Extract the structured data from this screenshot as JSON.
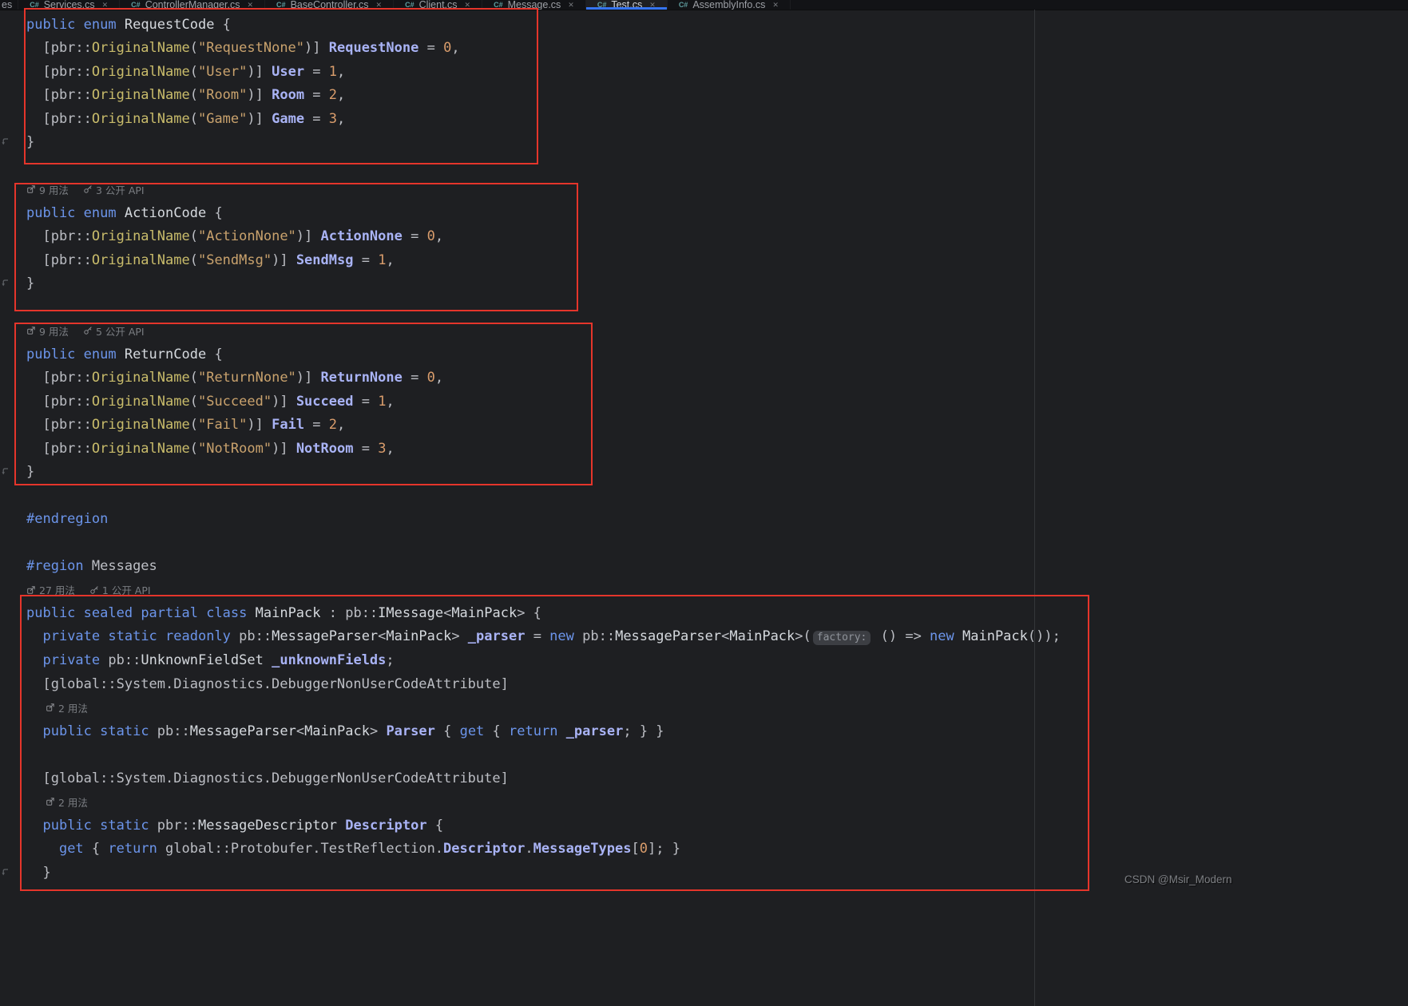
{
  "tabs": {
    "leading_fragment": "es",
    "icon_label": "C#",
    "close_glyph": "✕",
    "items": [
      {
        "label": "Services.cs",
        "active": false
      },
      {
        "label": "ControllerManager.cs",
        "active": false
      },
      {
        "label": "BaseController.cs",
        "active": false
      },
      {
        "label": "Client.cs",
        "active": false
      },
      {
        "label": "Message.cs",
        "active": false
      },
      {
        "label": "Test.cs",
        "active": true
      },
      {
        "label": "AssemblyInfo.cs",
        "active": false
      }
    ]
  },
  "watermark": {
    "text": "CSDN @Msir_Modern"
  },
  "colors": {
    "background": "#1E1F22",
    "annotation_red": "#E5352B",
    "active_tab_accent": "#3574F0",
    "keyword": "#6C95EB",
    "string": "#C9A26D",
    "number": "#DA9D6C",
    "member": "#A9B3F5",
    "method": "#C9BC6B"
  },
  "editor": {
    "lines": [
      {
        "type": "code",
        "tokens": [
          [
            "k",
            "public "
          ],
          [
            "k",
            "enum "
          ],
          [
            "t",
            "RequestCode"
          ],
          [
            "d",
            " {"
          ]
        ]
      },
      {
        "type": "code",
        "tokens": [
          [
            "d",
            "  [pbr::"
          ],
          [
            "m",
            "OriginalName"
          ],
          [
            "d",
            "("
          ],
          [
            "s",
            "\"RequestNone\""
          ],
          [
            "d",
            ")] "
          ],
          [
            "e",
            "RequestNone"
          ],
          [
            "d",
            " = "
          ],
          [
            "n",
            "0"
          ],
          [
            "d",
            ","
          ]
        ]
      },
      {
        "type": "code",
        "tokens": [
          [
            "d",
            "  [pbr::"
          ],
          [
            "m",
            "OriginalName"
          ],
          [
            "d",
            "("
          ],
          [
            "s",
            "\"User\""
          ],
          [
            "d",
            ")] "
          ],
          [
            "e",
            "User"
          ],
          [
            "d",
            " = "
          ],
          [
            "n",
            "1"
          ],
          [
            "d",
            ","
          ]
        ]
      },
      {
        "type": "code",
        "tokens": [
          [
            "d",
            "  [pbr::"
          ],
          [
            "m",
            "OriginalName"
          ],
          [
            "d",
            "("
          ],
          [
            "s",
            "\"Room\""
          ],
          [
            "d",
            ")] "
          ],
          [
            "e",
            "Room"
          ],
          [
            "d",
            " = "
          ],
          [
            "n",
            "2"
          ],
          [
            "d",
            ","
          ]
        ]
      },
      {
        "type": "code",
        "tokens": [
          [
            "d",
            "  [pbr::"
          ],
          [
            "m",
            "OriginalName"
          ],
          [
            "d",
            "("
          ],
          [
            "s",
            "\"Game\""
          ],
          [
            "d",
            ")] "
          ],
          [
            "e",
            "Game"
          ],
          [
            "d",
            " = "
          ],
          [
            "n",
            "3"
          ],
          [
            "d",
            ","
          ]
        ]
      },
      {
        "type": "code",
        "gutter": true,
        "tokens": [
          [
            "d",
            "}"
          ]
        ]
      },
      {
        "type": "blank"
      },
      {
        "type": "lens",
        "indent": 0,
        "items": [
          {
            "icon": "usages-icon",
            "text": "9 用法"
          },
          {
            "icon": "api-icon",
            "text": "3 公开 API"
          }
        ]
      },
      {
        "type": "code",
        "tokens": [
          [
            "k",
            "public "
          ],
          [
            "k",
            "enum "
          ],
          [
            "t",
            "ActionCode"
          ],
          [
            "d",
            " {"
          ]
        ]
      },
      {
        "type": "code",
        "tokens": [
          [
            "d",
            "  [pbr::"
          ],
          [
            "m",
            "OriginalName"
          ],
          [
            "d",
            "("
          ],
          [
            "s",
            "\"ActionNone\""
          ],
          [
            "d",
            ")] "
          ],
          [
            "e",
            "ActionNone"
          ],
          [
            "d",
            " = "
          ],
          [
            "n",
            "0"
          ],
          [
            "d",
            ","
          ]
        ]
      },
      {
        "type": "code",
        "tokens": [
          [
            "d",
            "  [pbr::"
          ],
          [
            "m",
            "OriginalName"
          ],
          [
            "d",
            "("
          ],
          [
            "s",
            "\"SendMsg\""
          ],
          [
            "d",
            ")] "
          ],
          [
            "e",
            "SendMsg"
          ],
          [
            "d",
            " = "
          ],
          [
            "n",
            "1"
          ],
          [
            "d",
            ","
          ]
        ]
      },
      {
        "type": "code",
        "gutter": true,
        "tokens": [
          [
            "d",
            "}"
          ]
        ]
      },
      {
        "type": "blank"
      },
      {
        "type": "lens",
        "indent": 0,
        "items": [
          {
            "icon": "usages-icon",
            "text": "9 用法"
          },
          {
            "icon": "api-icon",
            "text": "5 公开 API"
          }
        ]
      },
      {
        "type": "code",
        "tokens": [
          [
            "k",
            "public "
          ],
          [
            "k",
            "enum "
          ],
          [
            "t",
            "ReturnCode"
          ],
          [
            "d",
            " {"
          ]
        ]
      },
      {
        "type": "code",
        "tokens": [
          [
            "d",
            "  [pbr::"
          ],
          [
            "m",
            "OriginalName"
          ],
          [
            "d",
            "("
          ],
          [
            "s",
            "\"ReturnNone\""
          ],
          [
            "d",
            ")] "
          ],
          [
            "e",
            "ReturnNone"
          ],
          [
            "d",
            " = "
          ],
          [
            "n",
            "0"
          ],
          [
            "d",
            ","
          ]
        ]
      },
      {
        "type": "code",
        "tokens": [
          [
            "d",
            "  [pbr::"
          ],
          [
            "m",
            "OriginalName"
          ],
          [
            "d",
            "("
          ],
          [
            "s",
            "\"Succeed\""
          ],
          [
            "d",
            ")] "
          ],
          [
            "e",
            "Succeed"
          ],
          [
            "d",
            " = "
          ],
          [
            "n",
            "1"
          ],
          [
            "d",
            ","
          ]
        ]
      },
      {
        "type": "code",
        "tokens": [
          [
            "d",
            "  [pbr::"
          ],
          [
            "m",
            "OriginalName"
          ],
          [
            "d",
            "("
          ],
          [
            "s",
            "\"Fail\""
          ],
          [
            "d",
            ")] "
          ],
          [
            "e",
            "Fail"
          ],
          [
            "d",
            " = "
          ],
          [
            "n",
            "2"
          ],
          [
            "d",
            ","
          ]
        ]
      },
      {
        "type": "code",
        "tokens": [
          [
            "d",
            "  [pbr::"
          ],
          [
            "m",
            "OriginalName"
          ],
          [
            "d",
            "("
          ],
          [
            "s",
            "\"NotRoom\""
          ],
          [
            "d",
            ")] "
          ],
          [
            "e",
            "NotRoom"
          ],
          [
            "d",
            " = "
          ],
          [
            "n",
            "3"
          ],
          [
            "d",
            ","
          ]
        ]
      },
      {
        "type": "code",
        "gutter": true,
        "tokens": [
          [
            "d",
            "}"
          ]
        ]
      },
      {
        "type": "blank"
      },
      {
        "type": "code",
        "tokens": [
          [
            "dir",
            "#endregion"
          ]
        ]
      },
      {
        "type": "blank"
      },
      {
        "type": "code",
        "tokens": [
          [
            "dir",
            "#region"
          ],
          [
            "d",
            " Messages"
          ]
        ]
      },
      {
        "type": "lens",
        "indent": 0,
        "items": [
          {
            "icon": "usages-icon",
            "text": "27 用法"
          },
          {
            "icon": "api-icon",
            "text": "1 公开 API"
          }
        ]
      },
      {
        "type": "code",
        "tokens": [
          [
            "k",
            "public "
          ],
          [
            "k",
            "sealed "
          ],
          [
            "k",
            "partial "
          ],
          [
            "k",
            "class "
          ],
          [
            "t",
            "MainPack"
          ],
          [
            "d",
            " : pb::"
          ],
          [
            "t",
            "IMessage"
          ],
          [
            "d",
            "<"
          ],
          [
            "t",
            "MainPack"
          ],
          [
            "d",
            "> {"
          ]
        ]
      },
      {
        "type": "code",
        "tokens": [
          [
            "d",
            "  "
          ],
          [
            "k",
            "private "
          ],
          [
            "k",
            "static "
          ],
          [
            "k",
            "readonly "
          ],
          [
            "d",
            "pb::"
          ],
          [
            "t",
            "MessageParser"
          ],
          [
            "d",
            "<"
          ],
          [
            "t",
            "MainPack"
          ],
          [
            "d",
            "> "
          ],
          [
            "e",
            "_parser"
          ],
          [
            "d",
            " = "
          ],
          [
            "k",
            "new "
          ],
          [
            "d",
            "pb::"
          ],
          [
            "t",
            "MessageParser"
          ],
          [
            "d",
            "<"
          ],
          [
            "t",
            "MainPack"
          ],
          [
            "d",
            ">("
          ],
          [
            "h",
            "factory:"
          ],
          [
            "d",
            " () => "
          ],
          [
            "k",
            "new "
          ],
          [
            "t",
            "MainPack"
          ],
          [
            "d",
            "());"
          ]
        ]
      },
      {
        "type": "code",
        "tokens": [
          [
            "d",
            "  "
          ],
          [
            "k",
            "private "
          ],
          [
            "d",
            "pb::"
          ],
          [
            "t",
            "UnknownFieldSet"
          ],
          [
            "d",
            " "
          ],
          [
            "e",
            "_unknownFields"
          ],
          [
            "d",
            ";"
          ]
        ]
      },
      {
        "type": "code",
        "tokens": [
          [
            "d",
            "  [global::System.Diagnostics.DebuggerNonUserCodeAttribute]"
          ]
        ]
      },
      {
        "type": "lens",
        "indent": 1,
        "items": [
          {
            "icon": "usages-icon",
            "text": "2 用法"
          }
        ]
      },
      {
        "type": "code",
        "tokens": [
          [
            "d",
            "  "
          ],
          [
            "k",
            "public "
          ],
          [
            "k",
            "static "
          ],
          [
            "d",
            "pb::"
          ],
          [
            "t",
            "MessageParser"
          ],
          [
            "d",
            "<"
          ],
          [
            "t",
            "MainPack"
          ],
          [
            "d",
            "> "
          ],
          [
            "e",
            "Parser"
          ],
          [
            "d",
            " { "
          ],
          [
            "k",
            "get"
          ],
          [
            "d",
            " { "
          ],
          [
            "k",
            "return"
          ],
          [
            "d",
            " "
          ],
          [
            "e",
            "_parser"
          ],
          [
            "d",
            "; } }"
          ]
        ]
      },
      {
        "type": "blank"
      },
      {
        "type": "code",
        "tokens": [
          [
            "d",
            "  [global::System.Diagnostics.DebuggerNonUserCodeAttribute]"
          ]
        ]
      },
      {
        "type": "lens",
        "indent": 1,
        "items": [
          {
            "icon": "usages-icon",
            "text": "2 用法"
          }
        ]
      },
      {
        "type": "code",
        "tokens": [
          [
            "d",
            "  "
          ],
          [
            "k",
            "public "
          ],
          [
            "k",
            "static "
          ],
          [
            "d",
            "pbr::"
          ],
          [
            "t",
            "MessageDescriptor"
          ],
          [
            "d",
            " "
          ],
          [
            "e",
            "Descriptor"
          ],
          [
            "d",
            " {"
          ]
        ]
      },
      {
        "type": "code",
        "tokens": [
          [
            "d",
            "    "
          ],
          [
            "k",
            "get"
          ],
          [
            "d",
            " { "
          ],
          [
            "k",
            "return"
          ],
          [
            "d",
            " global::Protobufer.TestReflection."
          ],
          [
            "e",
            "Descriptor"
          ],
          [
            "d",
            "."
          ],
          [
            "e",
            "MessageTypes"
          ],
          [
            "d",
            "["
          ],
          [
            "n",
            "0"
          ],
          [
            "d",
            "]; }"
          ]
        ]
      },
      {
        "type": "code",
        "gutter": true,
        "tokens": [
          [
            "d",
            "  }"
          ]
        ]
      }
    ]
  }
}
